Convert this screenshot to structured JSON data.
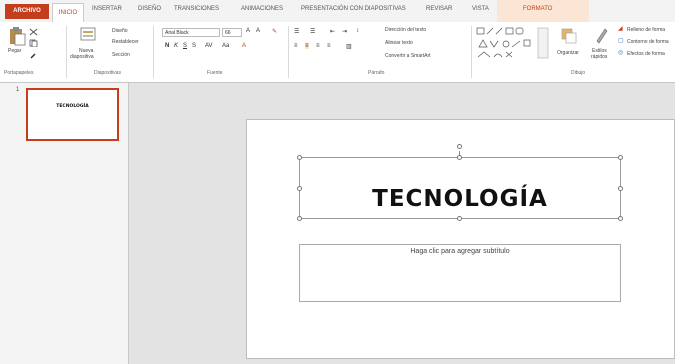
{
  "tabs": {
    "file": "ARCHIVO",
    "home": "INICIO",
    "insert": "INSERTAR",
    "design": "DISEÑO",
    "transitions": "TRANSICIONES",
    "animations": "ANIMACIONES",
    "slideshow": "PRESENTACIÓN CON DIAPOSITIVAS",
    "review": "REVISAR",
    "view": "VISTA",
    "format": "FORMATO"
  },
  "ribbon": {
    "clipboard": {
      "paste": "Pegar",
      "group": "Portapapeles"
    },
    "slides": {
      "new_slide_1": "Nueva",
      "new_slide_2": "diapositiva",
      "layout": "Diseño",
      "reset": "Restablecer",
      "section": "Sección",
      "group": "Diapositivas"
    },
    "font": {
      "font_name": "Arial Black",
      "font_size": "66",
      "bold": "N",
      "italic": "K",
      "underline": "S",
      "strike": "S",
      "group": "Fuente"
    },
    "paragraph": {
      "text_direction": "Dirección del texto",
      "align_text": "Alinear texto",
      "smartart": "Convertir a SmartArt",
      "group": "Párrafo"
    },
    "drawing": {
      "arrange": "Organizar",
      "quick_styles_1": "Estilos",
      "quick_styles_2": "rápidos",
      "shape_fill": "Relleno de forma",
      "shape_outline": "Contorno de forma",
      "shape_effects": "Efectos de forma",
      "group": "Dibujo"
    }
  },
  "thumbnails": [
    {
      "number": "1",
      "title": "TECNOLOGÍA"
    }
  ],
  "slide": {
    "title": "TECNOLOGÍA",
    "subtitle_placeholder": "Haga clic para agregar subtítulo"
  },
  "colors": {
    "accent": "#c43e1c"
  }
}
